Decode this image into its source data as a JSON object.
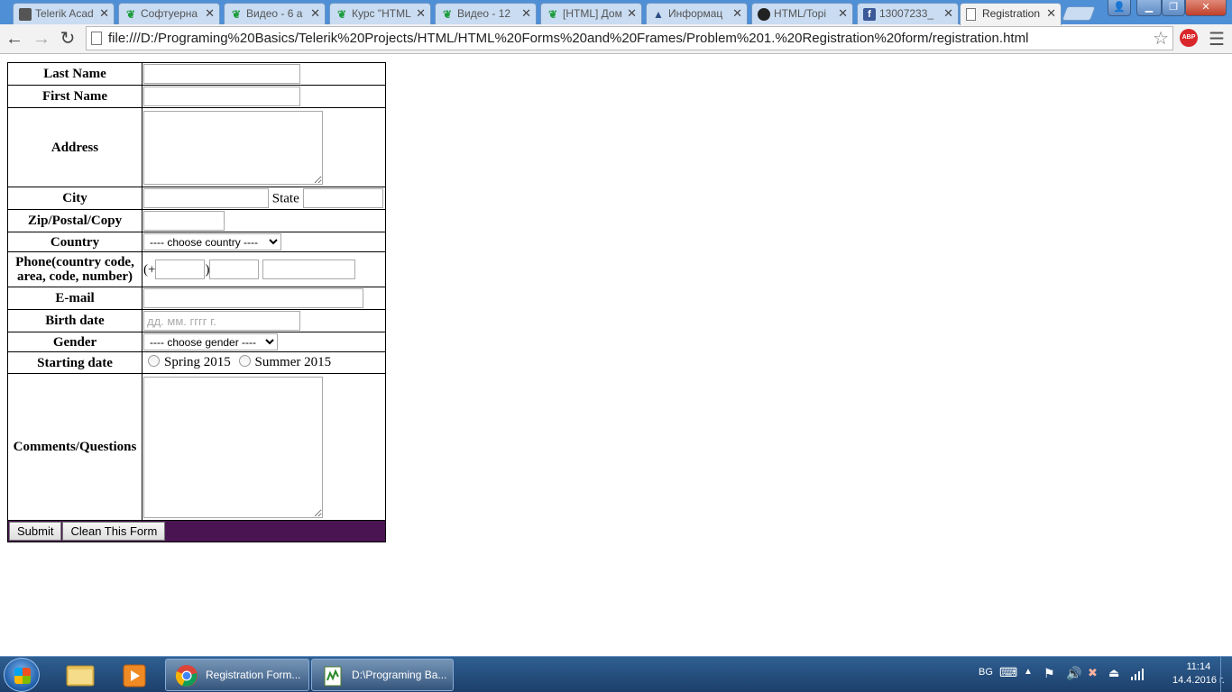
{
  "browser": {
    "tabs": [
      {
        "title": "Telerik Acad",
        "favicon": "grey-square-icon"
      },
      {
        "title": "Софтуерна",
        "favicon": "telerik-green-icon"
      },
      {
        "title": "Видео - 6 а",
        "favicon": "telerik-green-icon"
      },
      {
        "title": "Курс \"HTML",
        "favicon": "telerik-green-icon"
      },
      {
        "title": "Видео - 12",
        "favicon": "telerik-green-icon"
      },
      {
        "title": "[HTML] Дом",
        "favicon": "telerik-green-icon"
      },
      {
        "title": "Информац",
        "favicon": "graduation-cap-icon"
      },
      {
        "title": "HTML/Topi",
        "favicon": "github-icon"
      },
      {
        "title": "13007233_",
        "favicon": "facebook-icon"
      },
      {
        "title": "Registration",
        "favicon": "page-icon",
        "active": true
      }
    ],
    "url": "file:///D:/Programing%20Basics/Telerik%20Projects/HTML/HTML%20Forms%20and%20Frames/Problem%201.%20Registration%20form/registration.html",
    "abp_label": "ABP",
    "window_buttons": {
      "minimize": "▁",
      "maximize": "❐",
      "close": "✕"
    }
  },
  "form": {
    "last_name_label": "Last Name",
    "first_name_label": "First Name",
    "address_label": "Address",
    "city_label": "City",
    "state_label": "State",
    "zip_label": "Zip/Postal/Copy",
    "country_label": "Country",
    "country_selected": "---- choose country ----",
    "phone_label": "Phone(country code, area, code, number)",
    "phone_prefix": "(+",
    "phone_close": ")",
    "email_label": "E-mail",
    "birth_label": "Birth date",
    "birth_placeholder": "дд. мм. гггг г.",
    "gender_label": "Gender",
    "gender_selected": "---- choose gender ----",
    "start_label": "Starting date",
    "start_options": [
      "Spring 2015",
      "Summer 2015"
    ],
    "comments_label": "Comments/Questions",
    "submit_label": "Submit",
    "clear_label": "Clean This Form",
    "submit_row_color": "#4a1452"
  },
  "taskbar": {
    "tasks": [
      {
        "title": "Registration Form...",
        "icon": "chrome-icon"
      },
      {
        "title": "D:\\Programing Ba...",
        "icon": "notepad-plus-icon"
      }
    ],
    "language": "BG",
    "time": "11:14",
    "date": "14.4.2016 г."
  }
}
